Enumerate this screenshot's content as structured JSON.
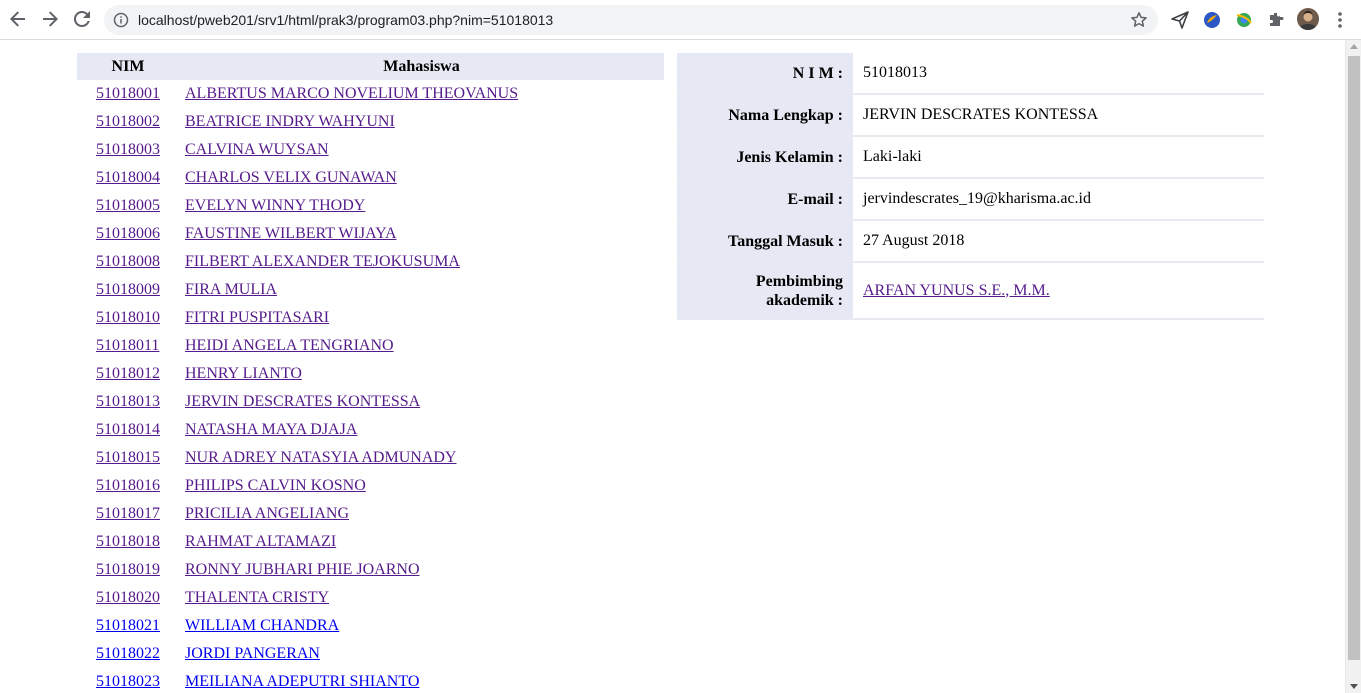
{
  "browser": {
    "url": "localhost/pweb201/srv1/html/prak3/program03.php?nim=51018013"
  },
  "list": {
    "headers": {
      "nim": "NIM",
      "mahasiswa": "Mahasiswa"
    },
    "rows": [
      {
        "nim": "51018001",
        "name": "ALBERTUS MARCO NOVELIUM THEOVANUS"
      },
      {
        "nim": "51018002",
        "name": "BEATRICE INDRY WAHYUNI"
      },
      {
        "nim": "51018003",
        "name": "CALVINA WUYSAN"
      },
      {
        "nim": "51018004",
        "name": "CHARLOS VELIX GUNAWAN"
      },
      {
        "nim": "51018005",
        "name": "EVELYN WINNY THODY"
      },
      {
        "nim": "51018006",
        "name": "FAUSTINE WILBERT WIJAYA"
      },
      {
        "nim": "51018008",
        "name": "FILBERT ALEXANDER TEJOKUSUMA"
      },
      {
        "nim": "51018009",
        "name": "FIRA MULIA"
      },
      {
        "nim": "51018010",
        "name": "FITRI PUSPITASARI"
      },
      {
        "nim": "51018011",
        "name": "HEIDI ANGELA TENGRIANO"
      },
      {
        "nim": "51018012",
        "name": "HENRY LIANTO"
      },
      {
        "nim": "51018013",
        "name": "JERVIN DESCRATES KONTESSA"
      },
      {
        "nim": "51018014",
        "name": "NATASHA MAYA DJAJA"
      },
      {
        "nim": "51018015",
        "name": "NUR ADREY NATASYIA ADMUNADY"
      },
      {
        "nim": "51018016",
        "name": "PHILIPS CALVIN KOSNO"
      },
      {
        "nim": "51018017",
        "name": "PRICILIA ANGELIANG"
      },
      {
        "nim": "51018018",
        "name": "RAHMAT ALTAMAZI"
      },
      {
        "nim": "51018019",
        "name": "RONNY JUBHARI PHIE JOARNO"
      },
      {
        "nim": "51018020",
        "name": "THALENTA CRISTY"
      },
      {
        "nim": "51018021",
        "name": "WILLIAM CHANDRA"
      },
      {
        "nim": "51018022",
        "name": "JORDI PANGERAN"
      },
      {
        "nim": "51018023",
        "name": "MEILIANA ADEPUTRI SHIANTO"
      }
    ]
  },
  "detail": {
    "nim_label": "N I M :",
    "nim_value": "51018013",
    "nama_label": "Nama Lengkap :",
    "nama_value": "JERVIN DESCRATES KONTESSA",
    "jk_label": "Jenis Kelamin :",
    "jk_value": "Laki-laki",
    "email_label": "E-mail :",
    "email_value": "jervindescrates_19@kharisma.ac.id",
    "tgl_label": "Tanggal Masuk :",
    "tgl_value": "27 August 2018",
    "pemb_label_1": "Pembimbing",
    "pemb_label_2": "akademik :",
    "pemb_value": "ARFAN YUNUS S.E., M.M."
  },
  "colors": {
    "visited_link": "#551a8b",
    "unvisited_link": "#0000ee",
    "header_bg": "#e6e8f4"
  },
  "icons": [
    "back-arrow-icon",
    "forward-arrow-icon",
    "reload-icon",
    "info-icon",
    "star-icon",
    "send-icon",
    "extension-icon",
    "puzzle-icon",
    "avatar",
    "menu-dots-icon"
  ]
}
